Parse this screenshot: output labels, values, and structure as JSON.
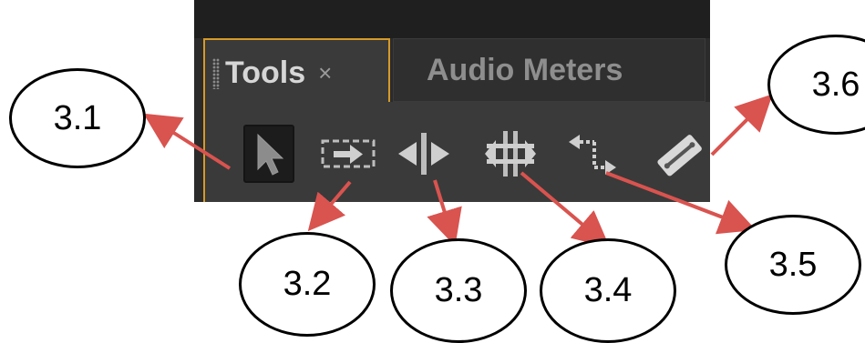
{
  "panel": {
    "tabs": [
      {
        "label": "Tools",
        "close_icon": "×",
        "active": true
      },
      {
        "label": "Audio Meters",
        "active": false
      }
    ],
    "tools": [
      {
        "id": "3.1",
        "icon": "selection-arrow-icon"
      },
      {
        "id": "3.2",
        "icon": "track-select-icon"
      },
      {
        "id": "3.3",
        "icon": "ripple-edit-icon"
      },
      {
        "id": "3.4",
        "icon": "rolling-edit-icon"
      },
      {
        "id": "3.5",
        "icon": "rate-stretch-icon"
      },
      {
        "id": "3.6",
        "icon": "razor-icon"
      }
    ]
  },
  "callouts": [
    {
      "label": "3.1"
    },
    {
      "label": "3.2"
    },
    {
      "label": "3.3"
    },
    {
      "label": "3.4"
    },
    {
      "label": "3.5"
    },
    {
      "label": "3.6"
    }
  ],
  "colors": {
    "accent": "#d59a28",
    "arrow": "#d9534f",
    "panel_bg": "#2b2b2b"
  }
}
